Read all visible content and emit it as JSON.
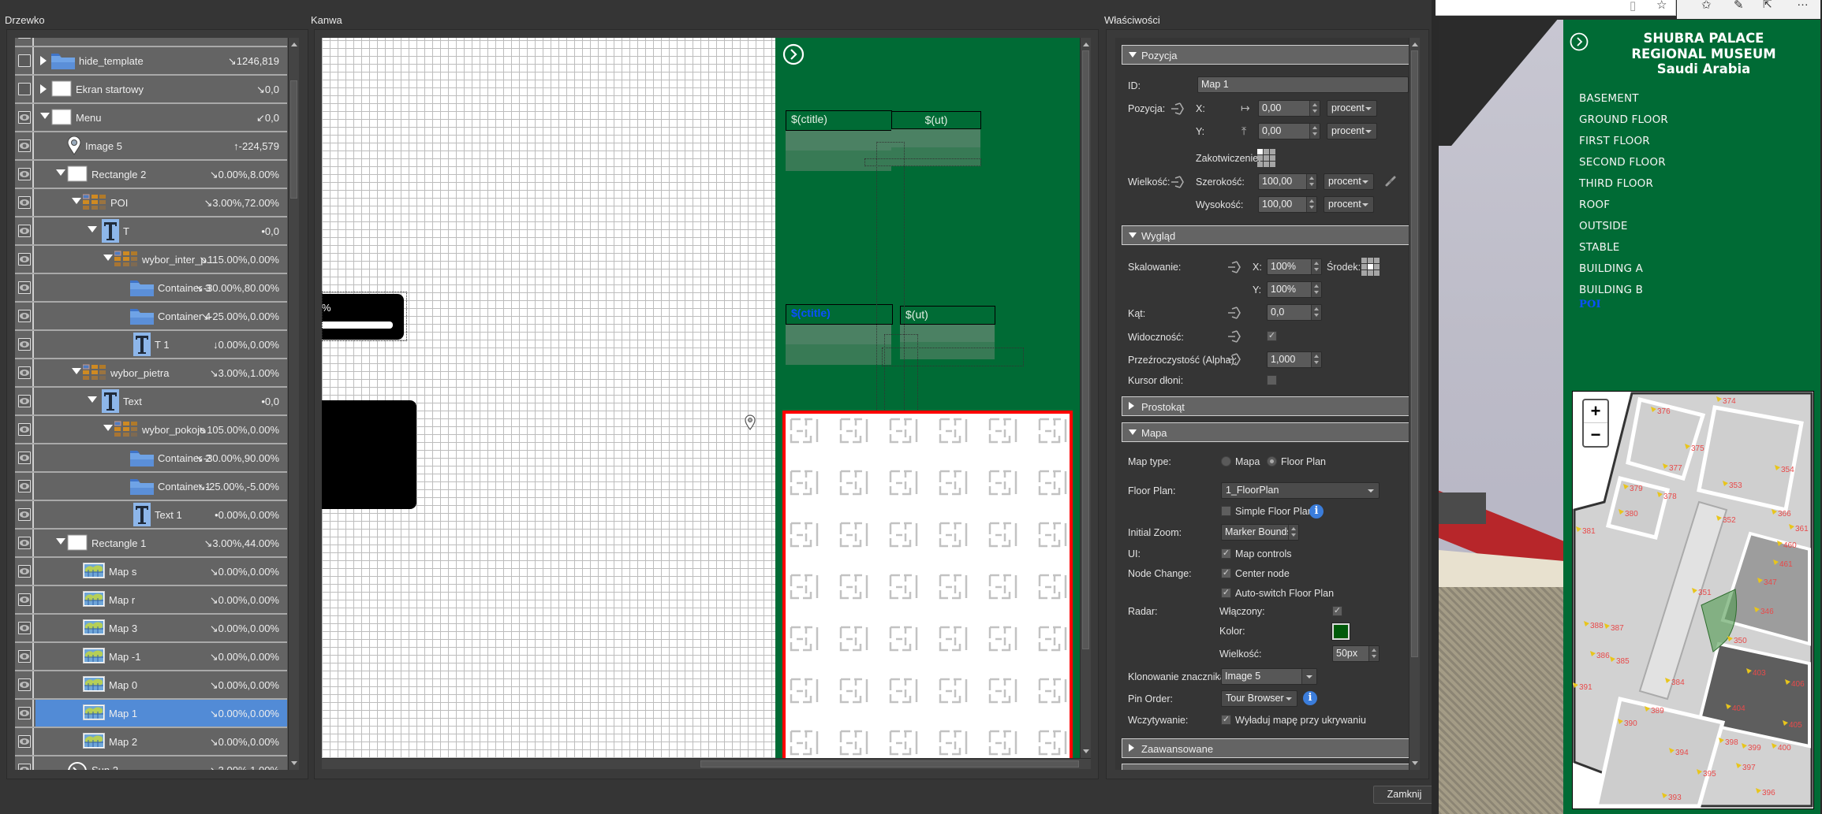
{
  "panels": {
    "tree_title": "Drzewko",
    "canvas_title": "Kanwa",
    "props_title": "Właściwości"
  },
  "tree": {
    "rows": [
      {
        "name": "",
        "value": "",
        "level": 0,
        "icon": "bookmark-icon",
        "exp": "none",
        "vis": "checkbox"
      },
      {
        "name": "hide_template",
        "value": "↘1246,819",
        "level": 0,
        "icon": "folder-icon",
        "exp": "closed",
        "vis": "checkbox"
      },
      {
        "name": "Ekran startowy",
        "value": "↘0,0",
        "level": 0,
        "icon": "rectangle-icon",
        "exp": "closed",
        "vis": "checkbox"
      },
      {
        "name": "Menu",
        "value": "↙0,0",
        "level": 0,
        "icon": "rectangle-icon",
        "exp": "open",
        "vis": "eye"
      },
      {
        "name": "Image 5",
        "value": "↑-224,579",
        "level": 1,
        "icon": "pin-icon",
        "exp": "none",
        "vis": "eye"
      },
      {
        "name": "Rectangle 2",
        "value": "↘0.00%,8.00%",
        "level": 1,
        "icon": "rectangle-icon",
        "exp": "open",
        "vis": "eye"
      },
      {
        "name": "POI",
        "value": "↘3.00%,72.00%",
        "level": 2,
        "icon": "grid-icon",
        "exp": "open",
        "vis": "eye"
      },
      {
        "name": "T",
        "value": "•0,0",
        "level": 3,
        "icon": "text-icon",
        "exp": "open",
        "vis": "eye"
      },
      {
        "name": "wybor_inter_p...",
        "value": "↘115.00%,0.00%",
        "level": 4,
        "icon": "grid-icon",
        "exp": "open",
        "vis": "eye"
      },
      {
        "name": "Container 3",
        "value": "↘-30.00%,80.00%",
        "level": 5,
        "icon": "folder-icon",
        "exp": "none",
        "vis": "eye"
      },
      {
        "name": "Container 4",
        "value": "↘-25.00%,0.00%",
        "level": 5,
        "icon": "folder-icon",
        "exp": "none",
        "vis": "eye"
      },
      {
        "name": "T 1",
        "value": "↓0.00%,0.00%",
        "level": 5,
        "icon": "text-icon",
        "exp": "none",
        "vis": "eye"
      },
      {
        "name": "wybor_pietra",
        "value": "↘3.00%,1.00%",
        "level": 2,
        "icon": "grid-icon",
        "exp": "open",
        "vis": "eye"
      },
      {
        "name": "Text",
        "value": "•0,0",
        "level": 3,
        "icon": "text-icon",
        "exp": "open",
        "vis": "eye"
      },
      {
        "name": "wybor_pokoje",
        "value": "↘105.00%,0.00%",
        "level": 4,
        "icon": "grid-icon",
        "exp": "open",
        "vis": "eye"
      },
      {
        "name": "Container 2",
        "value": "↘-30.00%,90.00%",
        "level": 5,
        "icon": "folder-icon",
        "exp": "none",
        "vis": "eye"
      },
      {
        "name": "Container 1",
        "value": "↘-25.00%,-5.00%",
        "level": 5,
        "icon": "folder-icon",
        "exp": "none",
        "vis": "eye"
      },
      {
        "name": "Text 1",
        "value": "•0.00%,0.00%",
        "level": 5,
        "icon": "text-icon",
        "exp": "none",
        "vis": "eye"
      },
      {
        "name": "Rectangle 1",
        "value": "↘3.00%,44.00%",
        "level": 1,
        "icon": "rectangle-icon",
        "exp": "open",
        "vis": "eye"
      },
      {
        "name": "Map s",
        "value": "↘0.00%,0.00%",
        "level": 2,
        "icon": "map-icon",
        "exp": "none",
        "vis": "eye"
      },
      {
        "name": "Map r",
        "value": "↘0.00%,0.00%",
        "level": 2,
        "icon": "map-icon",
        "exp": "none",
        "vis": "eye"
      },
      {
        "name": "Map 3",
        "value": "↘0.00%,0.00%",
        "level": 2,
        "icon": "map-icon",
        "exp": "none",
        "vis": "eye"
      },
      {
        "name": "Map -1",
        "value": "↘0.00%,0.00%",
        "level": 2,
        "icon": "map-icon",
        "exp": "none",
        "vis": "eye"
      },
      {
        "name": "Map 0",
        "value": "↘0.00%,0.00%",
        "level": 2,
        "icon": "map-icon",
        "exp": "none",
        "vis": "eye"
      },
      {
        "name": "Map 1",
        "value": "↘0.00%,0.00%",
        "level": 2,
        "icon": "map-icon",
        "exp": "none",
        "vis": "eye",
        "selected": true
      },
      {
        "name": "Map 2",
        "value": "↘0.00%,0.00%",
        "level": 2,
        "icon": "map-icon",
        "exp": "none",
        "vis": "eye"
      },
      {
        "name": "Sun 2",
        "value": "↘3.00%,1.00%",
        "level": 1,
        "icon": "compass-icon",
        "exp": "none",
        "vis": "eye"
      }
    ]
  },
  "canvas": {
    "fragment_text": "%",
    "table1": {
      "col1": "$(ctitle)",
      "col2": "$(ut)"
    },
    "table2": {
      "col1": "$(ctitle)",
      "col2": "$(ut)"
    },
    "colors": {
      "green": "#006b35",
      "selection": "#ff0000",
      "ctitle_highlight": "#0a4fff"
    }
  },
  "props": {
    "pozycja": {
      "header": "Pozycja",
      "id_label": "ID:",
      "id_value": "Map 1",
      "pos_label": "Pozycja:",
      "x_label": "X:",
      "x_value": "0,00",
      "x_unit": "procent",
      "y_label": "Y:",
      "y_value": "0,00",
      "y_unit": "procent",
      "anchor_label": "Zakotwiczenie:",
      "size_label": "Wielkość:",
      "width_label": "Szerokość:",
      "width_value": "100,00",
      "width_unit": "procent",
      "height_label": "Wysokość:",
      "height_value": "100,00",
      "height_unit": "procent"
    },
    "wyglad": {
      "header": "Wygląd",
      "scale_label": "Skalowanie:",
      "sx_label": "X:",
      "sx_value": "100%",
      "center_label": "Środek:",
      "sy_label": "Y:",
      "sy_value": "100%",
      "angle_label": "Kąt:",
      "angle_value": "0,0",
      "visibility_label": "Widoczność:",
      "visibility": true,
      "alpha_label": "Przeźroczystość (Alpha):",
      "alpha_value": "1,000",
      "cursor_label": "Kursor dłoni:",
      "cursor": false
    },
    "prostokat": {
      "header": "Prostokąt"
    },
    "mapa": {
      "header": "Mapa",
      "type_label": "Map type:",
      "type_opt1": "Mapa",
      "type_opt2": "Floor Plan",
      "type_selected": "Floor Plan",
      "fp_label": "Floor Plan:",
      "fp_value": "1_FloorPlan",
      "simple_label": "Simple Floor Plan",
      "simple": false,
      "zoom_label": "Initial Zoom:",
      "zoom_value": "Marker Bounds",
      "ui_label": "UI:",
      "ui_opt": "Map controls",
      "ui": true,
      "node_label": "Node Change:",
      "center_node": "Center node",
      "center_node_checked": true,
      "autoswitch": "Auto-switch Floor Plan",
      "autoswitch_checked": true,
      "radar_label": "Radar:",
      "radar_on_label": "Włączony:",
      "radar_on": true,
      "radar_color_label": "Kolor:",
      "radar_color": "#005a0a",
      "radar_size_label": "Wielkość:",
      "radar_size": "50px",
      "clone_label": "Klonowanie znacznika:",
      "clone_value": "Image 5",
      "pin_label": "Pin Order:",
      "pin_value": "Tour Browser",
      "load_label": "Wczytywanie:",
      "load_opt": "Wyładuj mapę przy ukrywaniu",
      "load_checked": true
    },
    "zaawansowane": {
      "header": "Zaawansowane"
    }
  },
  "close_button": "Zamknij",
  "preview": {
    "title_lines": [
      "SHUBRA PALACE",
      "REGIONAL MUSEUM",
      "Saudi Arabia"
    ],
    "menu": [
      "BASEMENT",
      "GROUND FLOOR",
      "FIRST FLOOR",
      "SECOND FLOOR",
      "THIRD FLOOR",
      "ROOF",
      "OUTSIDE",
      "STABLE",
      "BUILDING A",
      "BUILDING B"
    ],
    "poi": "POI",
    "zoom_in": "+",
    "zoom_out": "−",
    "markers": [
      "374",
      "376",
      "375",
      "377",
      "354",
      "353",
      "379",
      "378",
      "380",
      "352",
      "366",
      "361",
      "381",
      "460",
      "461",
      "347",
      "351",
      "346",
      "388",
      "387",
      "350",
      "386",
      "385",
      "403",
      "406",
      "384",
      "391",
      "404",
      "389",
      "405",
      "390",
      "398",
      "399",
      "400",
      "394",
      "397",
      "395",
      "396",
      "393"
    ],
    "colors": {
      "panel_green": "#006b35",
      "poi_blue": "#0a4fff",
      "marker_red": "#e84a4a"
    }
  }
}
